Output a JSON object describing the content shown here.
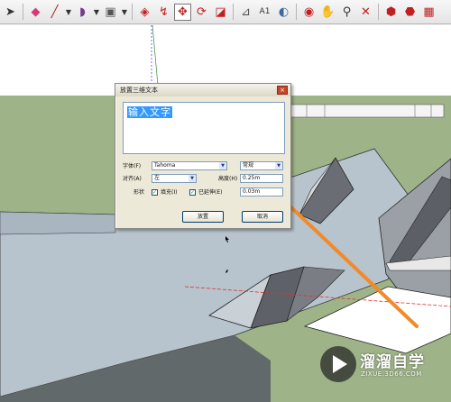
{
  "toolbar": {
    "icons": [
      "select-arrow",
      "eraser",
      "pencil-line",
      "arc",
      "rectangle",
      "push-pull",
      "follow-me",
      "move",
      "rotate",
      "scale",
      "tape-measure",
      "text",
      "paint-bucket",
      "orbit",
      "pan",
      "zoom",
      "zoom-extents",
      "component-1",
      "component-2",
      "component-3"
    ],
    "active": "move"
  },
  "dialog": {
    "title": "放置三维文本",
    "close": "×",
    "text_value": "输入文字",
    "font_label": "字体(F)",
    "font_value": "Tahoma",
    "style_value": "常规",
    "align_label": "对齐(A)",
    "align_value": "左",
    "height_label": "高度(H)",
    "height_value": "0.25m",
    "form_label": "形状",
    "fill_label": "填充(I)",
    "extrude_label": "已延伸(E)",
    "extrude_value": "0.03m",
    "fill_checked": "✓",
    "extrude_checked": "✓",
    "place_button": "放置",
    "cancel_button": "取消"
  },
  "watermark": {
    "title": "溜溜自学",
    "subtitle": "ZIXUE.3D66.COM"
  },
  "colors": {
    "sky": "#ffffff",
    "ground": "#9eb488",
    "surface": "#b7c3cd",
    "dark_face": "#6a6e74",
    "arrow": "#f08a2a",
    "selection": "#3399ff"
  }
}
